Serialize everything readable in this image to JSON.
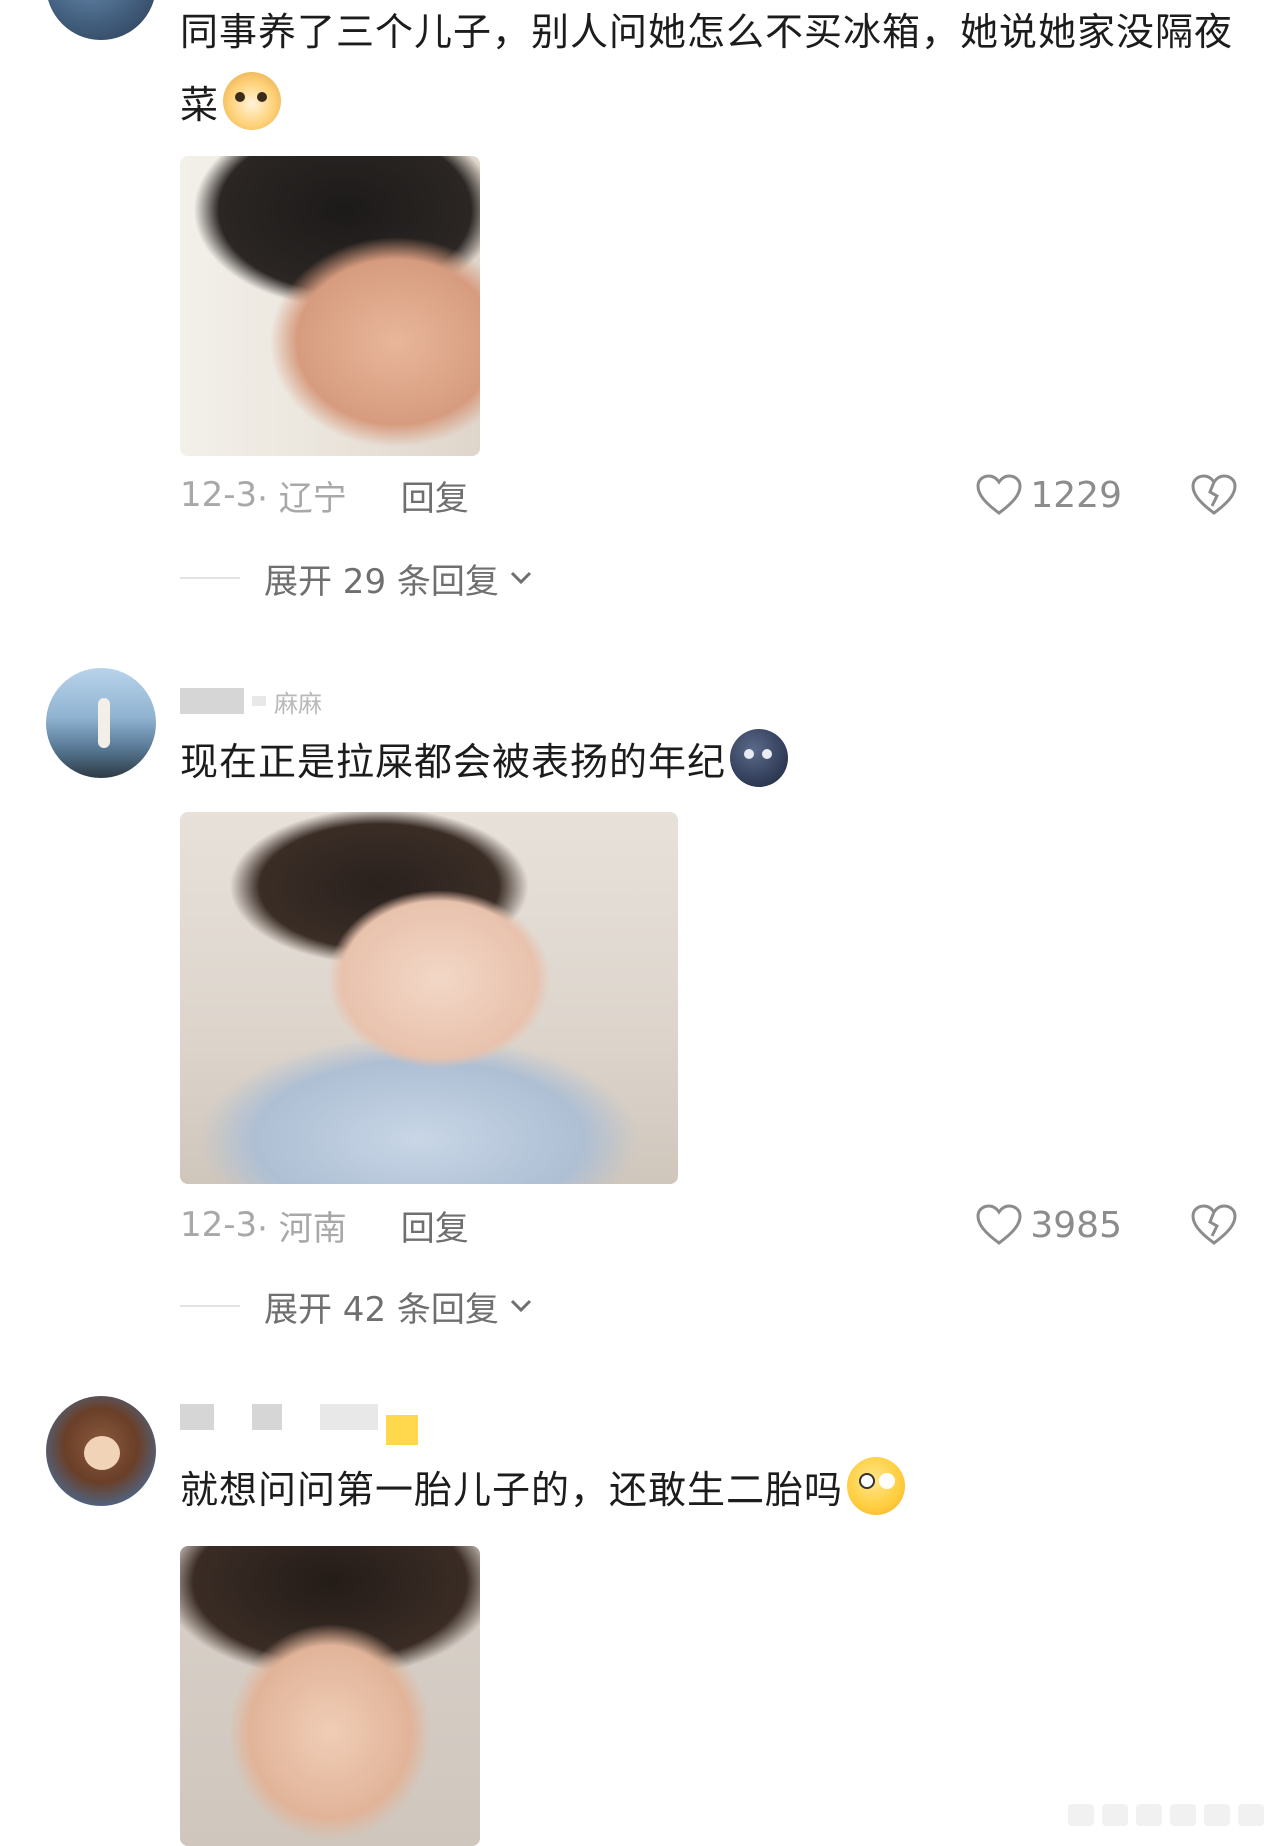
{
  "comments": [
    {
      "text": "同事养了三个儿子，别人问她怎么不买冰箱，她说她家没隔夜菜",
      "emoji": "dog-face-emoji",
      "date": "12-3",
      "location": "· 辽宁",
      "reply_label": "回复",
      "likes": "1229",
      "expand_label": "展开 29 条回复"
    },
    {
      "username_visible": "麻麻",
      "text": "现在正是拉屎都会被表扬的年纪",
      "emoji": "new-moon-face-emoji",
      "date": "12-3",
      "location": "· 河南",
      "reply_label": "回复",
      "likes": "3985",
      "expand_label": "展开 42 条回复"
    },
    {
      "text": "就想问问第一胎儿子的，还敢生二胎吗",
      "emoji": "thinking-face-emoji"
    }
  ],
  "colors": {
    "text": "#1c1c1c",
    "meta": "#a8a8a8",
    "reply": "#6f6f6f"
  }
}
